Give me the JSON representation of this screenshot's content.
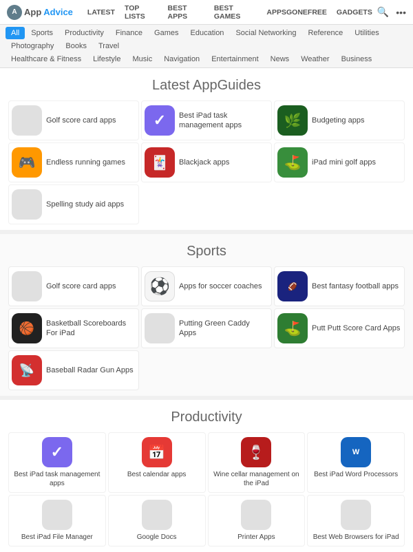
{
  "logo": {
    "icon": "A",
    "app": "App",
    "advice": "Advice"
  },
  "topNav": {
    "items": [
      "LATEST",
      "TOP LISTS",
      "BEST APPS",
      "BEST GAMES",
      "APPSGONEFREE",
      "GADGETS"
    ]
  },
  "categories": {
    "row1": [
      "All",
      "Sports",
      "Productivity",
      "Finance",
      "Games",
      "Education",
      "Social Networking",
      "Reference",
      "Utilities",
      "Photography",
      "Books",
      "Travel"
    ],
    "row2": [
      "Healthcare & Fitness",
      "Lifestyle",
      "Music",
      "Navigation",
      "Entertainment",
      "News",
      "Weather",
      "Business"
    ]
  },
  "sections": [
    {
      "title": "Latest AppGuides",
      "items": [
        {
          "label": "Golf score card apps",
          "icon": "placeholder"
        },
        {
          "label": "Best iPad task management apps",
          "icon": "check-purple"
        },
        {
          "label": "Budgeting apps",
          "icon": "leaf-green"
        },
        {
          "label": "Endless running games",
          "icon": "game-orange"
        },
        {
          "label": "Blackjack apps",
          "icon": "cards-red"
        },
        {
          "label": "iPad mini golf apps",
          "icon": "golf-green"
        },
        {
          "label": "Spelling study aid apps",
          "icon": "placeholder"
        }
      ]
    },
    {
      "title": "Sports",
      "items": [
        {
          "label": "Golf score card apps",
          "icon": "placeholder"
        },
        {
          "label": "Apps for soccer coaches",
          "icon": "soccer-ball"
        },
        {
          "label": "Best fantasy football apps",
          "icon": "football-dark"
        },
        {
          "label": "Basketball Scoreboards For iPad",
          "icon": "basketball-score"
        },
        {
          "label": "Putting Green Caddy Apps",
          "icon": "placeholder"
        },
        {
          "label": "Putt Putt Score Card Apps",
          "icon": "golf-putt"
        },
        {
          "label": "Baseball Radar Gun Apps",
          "icon": "radar"
        }
      ]
    },
    {
      "title": "Productivity",
      "items": [
        {
          "label": "Best iPad task management apps",
          "icon": "check-purple"
        },
        {
          "label": "Best calendar apps",
          "icon": "calendar-red"
        },
        {
          "label": "Wine cellar management on the iPad",
          "icon": "wine-red"
        },
        {
          "label": "Best iPad Word Processors",
          "icon": "word-blue"
        },
        {
          "label": "Best iPad File Manager",
          "icon": "placeholder"
        },
        {
          "label": "Google Docs",
          "icon": "placeholder"
        },
        {
          "label": "Printer Apps",
          "icon": "placeholder"
        },
        {
          "label": "Best Web Browsers for iPad",
          "icon": "placeholder"
        }
      ]
    }
  ]
}
